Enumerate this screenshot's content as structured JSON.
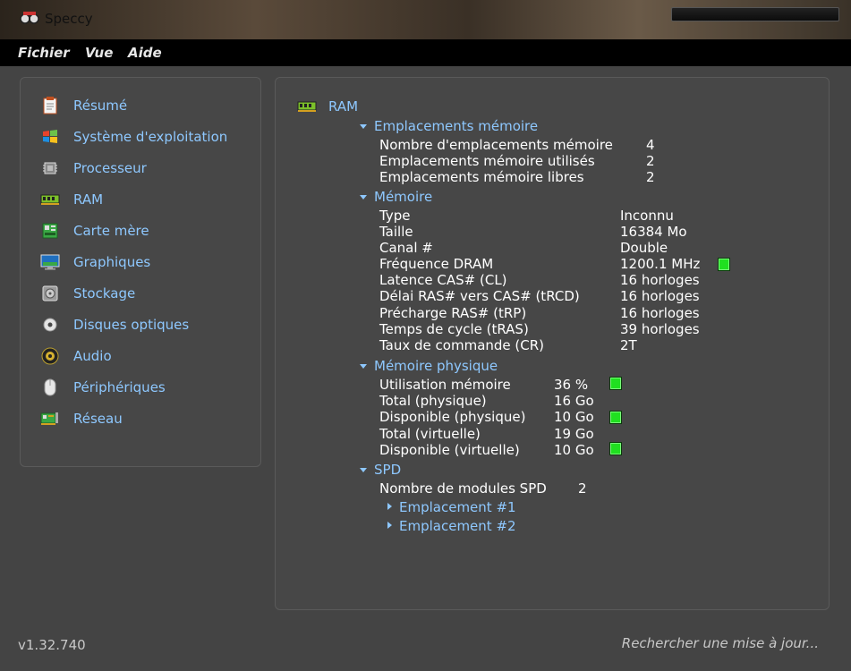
{
  "app": {
    "title": "Speccy",
    "version": "v1.32.740",
    "update_link": "Rechercher une mise à jour..."
  },
  "menu": [
    "Fichier",
    "Vue",
    "Aide"
  ],
  "sidebar": {
    "items": [
      {
        "label": "Résumé",
        "icon": "summary-icon"
      },
      {
        "label": "Système d'exploitation",
        "icon": "windows-icon"
      },
      {
        "label": "Processeur",
        "icon": "cpu-icon"
      },
      {
        "label": "RAM",
        "icon": "ram-icon"
      },
      {
        "label": "Carte mère",
        "icon": "motherboard-icon"
      },
      {
        "label": "Graphiques",
        "icon": "monitor-icon"
      },
      {
        "label": "Stockage",
        "icon": "hdd-icon"
      },
      {
        "label": "Disques optiques",
        "icon": "optical-disc-icon"
      },
      {
        "label": "Audio",
        "icon": "speaker-icon"
      },
      {
        "label": "Périphériques",
        "icon": "mouse-icon"
      },
      {
        "label": "Réseau",
        "icon": "network-icon"
      }
    ]
  },
  "main": {
    "title": "RAM",
    "slots": {
      "header": "Emplacements mémoire",
      "rows": [
        {
          "label": "Nombre d'emplacements mémoire",
          "value": "4"
        },
        {
          "label": "Emplacements mémoire utilisés",
          "value": "2"
        },
        {
          "label": "Emplacements mémoire libres",
          "value": "2"
        }
      ]
    },
    "memory": {
      "header": "Mémoire",
      "rows": [
        {
          "label": "Type",
          "value": "Inconnu"
        },
        {
          "label": "Taille",
          "value": "16384 Mo"
        },
        {
          "label": "Canal #",
          "value": "Double"
        },
        {
          "label": "Fréquence DRAM",
          "value": "1200.1 MHz"
        },
        {
          "label": "Latence CAS# (CL)",
          "value": "16 horloges"
        },
        {
          "label": "Délai RAS# vers CAS# (tRCD)",
          "value": "16 horloges"
        },
        {
          "label": "Précharge RAS# (tRP)",
          "value": "16 horloges"
        },
        {
          "label": "Temps de cycle (tRAS)",
          "value": "39 horloges"
        },
        {
          "label": "Taux de commande (CR)",
          "value": "2T"
        }
      ]
    },
    "physical": {
      "header": "Mémoire physique",
      "rows": [
        {
          "label": "Utilisation mémoire",
          "value": "36 %"
        },
        {
          "label": "Total (physique)",
          "value": "16 Go"
        },
        {
          "label": "Disponible (physique)",
          "value": "10 Go"
        },
        {
          "label": "Total (virtuelle)",
          "value": "19 Go"
        },
        {
          "label": "Disponible (virtuelle)",
          "value": "10 Go"
        }
      ]
    },
    "spd": {
      "header": "SPD",
      "modules_label": "Nombre de modules SPD",
      "modules_value": "2",
      "slots": [
        "Emplacement #1",
        "Emplacement #2"
      ]
    }
  },
  "colors": {
    "accent_blue": "#8ec8ff",
    "indicator_green": "#20e020"
  }
}
